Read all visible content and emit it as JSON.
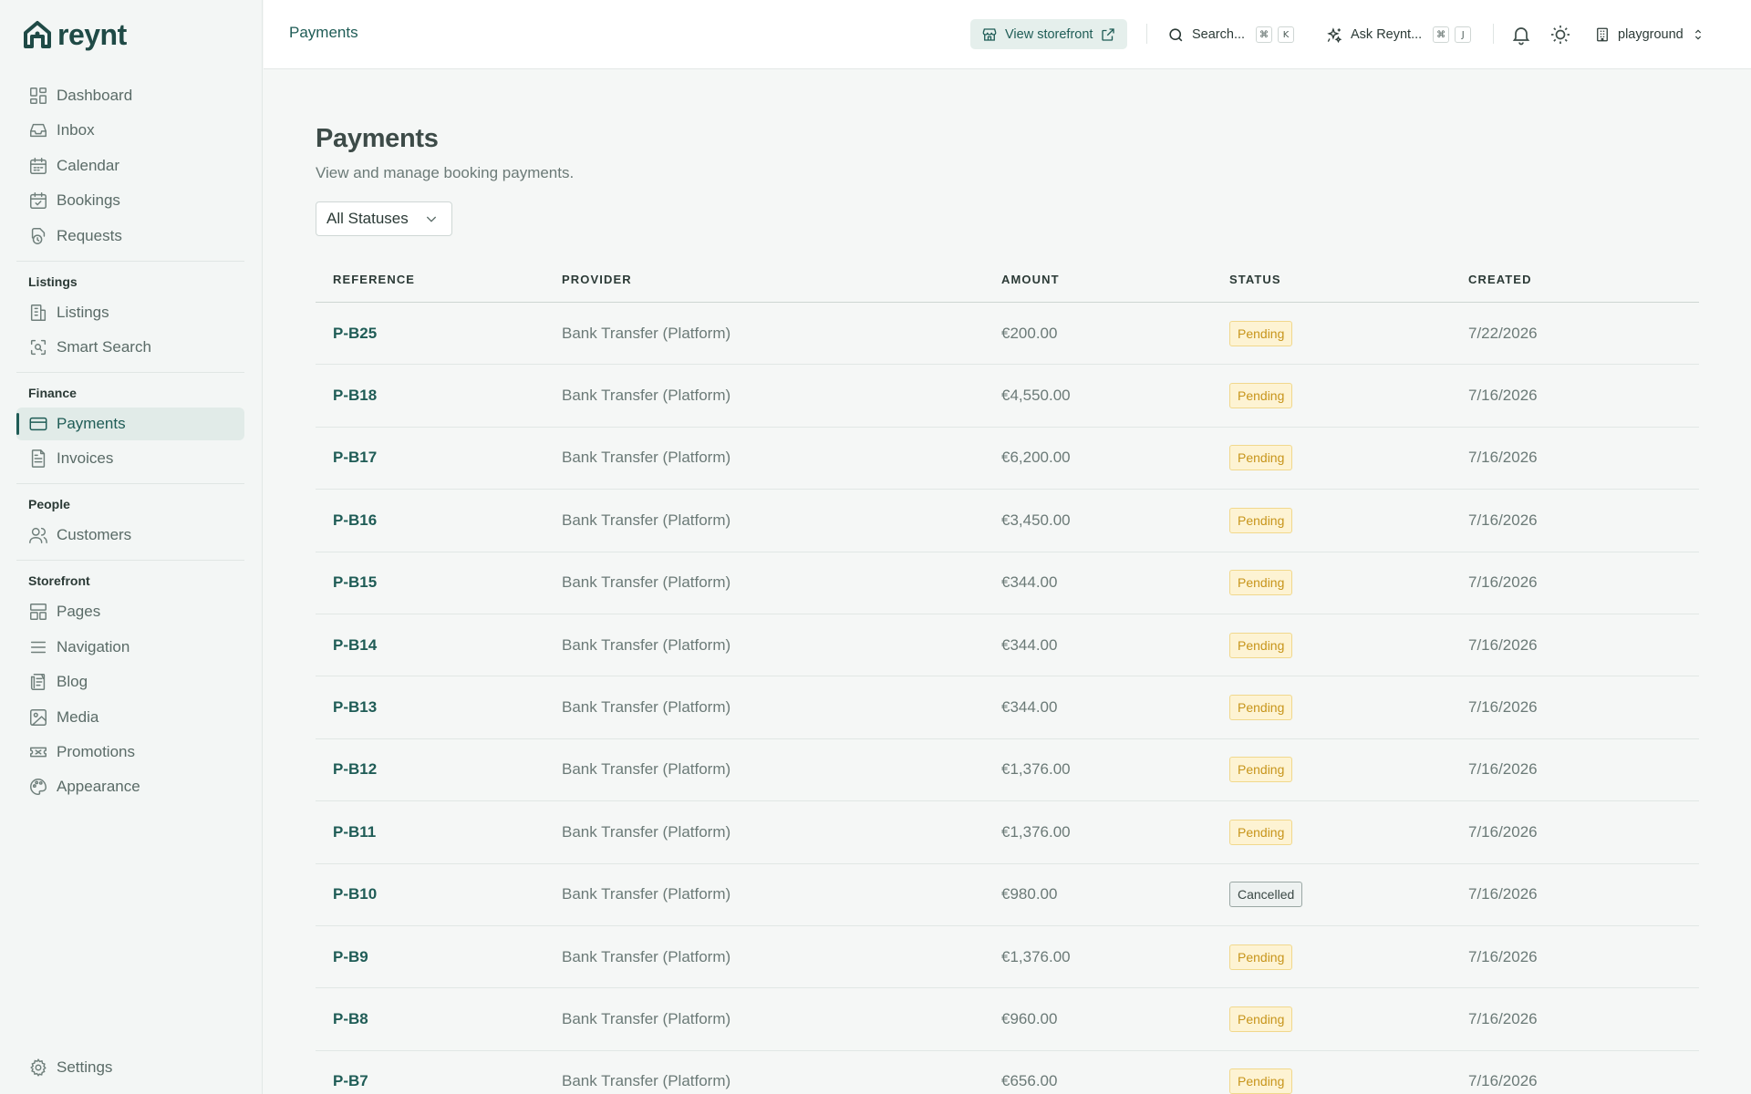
{
  "app": {
    "name": "reynt"
  },
  "sidebar": {
    "top_items": [
      {
        "label": "Dashboard",
        "icon": "dashboard-icon"
      },
      {
        "label": "Inbox",
        "icon": "inbox-icon"
      },
      {
        "label": "Calendar",
        "icon": "calendar-icon"
      },
      {
        "label": "Bookings",
        "icon": "calendar-check-icon"
      },
      {
        "label": "Requests",
        "icon": "requests-icon"
      }
    ],
    "sections": [
      {
        "title": "Listings",
        "items": [
          {
            "label": "Listings",
            "icon": "building-icon"
          },
          {
            "label": "Smart Search",
            "icon": "smart-search-icon"
          }
        ]
      },
      {
        "title": "Finance",
        "items": [
          {
            "label": "Payments",
            "icon": "credit-card-icon",
            "active": true
          },
          {
            "label": "Invoices",
            "icon": "invoice-icon"
          }
        ]
      },
      {
        "title": "People",
        "items": [
          {
            "label": "Customers",
            "icon": "users-icon"
          }
        ]
      },
      {
        "title": "Storefront",
        "items": [
          {
            "label": "Pages",
            "icon": "layout-icon"
          },
          {
            "label": "Navigation",
            "icon": "menu-icon"
          },
          {
            "label": "Blog",
            "icon": "blog-icon"
          },
          {
            "label": "Media",
            "icon": "image-icon"
          },
          {
            "label": "Promotions",
            "icon": "ticket-icon"
          },
          {
            "label": "Appearance",
            "icon": "palette-icon"
          }
        ]
      }
    ],
    "settings_label": "Settings"
  },
  "header": {
    "title": "Payments",
    "storefront_label": "View storefront",
    "search_label": "Search...",
    "search_keys": [
      "⌘",
      "K"
    ],
    "ask_label": "Ask Reynt...",
    "ask_keys": [
      "⌘",
      "J"
    ],
    "org_name": "playground"
  },
  "page": {
    "title": "Payments",
    "subtitle": "View and manage booking payments.",
    "filter_value": "All Statuses"
  },
  "table": {
    "columns": [
      "REFERENCE",
      "PROVIDER",
      "AMOUNT",
      "STATUS",
      "CREATED"
    ],
    "rows": [
      {
        "ref": "P-B25",
        "provider": "Bank Transfer (Platform)",
        "amount": "€200.00",
        "status": "Pending",
        "created": "7/22/2026"
      },
      {
        "ref": "P-B18",
        "provider": "Bank Transfer (Platform)",
        "amount": "€4,550.00",
        "status": "Pending",
        "created": "7/16/2026"
      },
      {
        "ref": "P-B17",
        "provider": "Bank Transfer (Platform)",
        "amount": "€6,200.00",
        "status": "Pending",
        "created": "7/16/2026"
      },
      {
        "ref": "P-B16",
        "provider": "Bank Transfer (Platform)",
        "amount": "€3,450.00",
        "status": "Pending",
        "created": "7/16/2026"
      },
      {
        "ref": "P-B15",
        "provider": "Bank Transfer (Platform)",
        "amount": "€344.00",
        "status": "Pending",
        "created": "7/16/2026"
      },
      {
        "ref": "P-B14",
        "provider": "Bank Transfer (Platform)",
        "amount": "€344.00",
        "status": "Pending",
        "created": "7/16/2026"
      },
      {
        "ref": "P-B13",
        "provider": "Bank Transfer (Platform)",
        "amount": "€344.00",
        "status": "Pending",
        "created": "7/16/2026"
      },
      {
        "ref": "P-B12",
        "provider": "Bank Transfer (Platform)",
        "amount": "€1,376.00",
        "status": "Pending",
        "created": "7/16/2026"
      },
      {
        "ref": "P-B11",
        "provider": "Bank Transfer (Platform)",
        "amount": "€1,376.00",
        "status": "Pending",
        "created": "7/16/2026"
      },
      {
        "ref": "P-B10",
        "provider": "Bank Transfer (Platform)",
        "amount": "€980.00",
        "status": "Cancelled",
        "created": "7/16/2026"
      },
      {
        "ref": "P-B9",
        "provider": "Bank Transfer (Platform)",
        "amount": "€1,376.00",
        "status": "Pending",
        "created": "7/16/2026"
      },
      {
        "ref": "P-B8",
        "provider": "Bank Transfer (Platform)",
        "amount": "€960.00",
        "status": "Pending",
        "created": "7/16/2026"
      },
      {
        "ref": "P-B7",
        "provider": "Bank Transfer (Platform)",
        "amount": "€656.00",
        "status": "Pending",
        "created": "7/16/2026"
      }
    ]
  },
  "colors": {
    "brand": "#1f5c56",
    "pending_bg": "#fdf3d3",
    "pending_text": "#c7951b",
    "cancelled_border": "#9aa7a4"
  }
}
